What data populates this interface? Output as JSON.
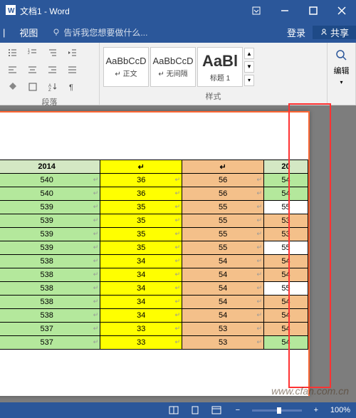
{
  "titlebar": {
    "title": "文档1 - Word"
  },
  "menubar": {
    "view_tab": "视图",
    "tell_me": "告诉我您想要做什么...",
    "login": "登录",
    "share": "共享"
  },
  "ribbon": {
    "paragraph_label": "段落",
    "styles_label": "样式",
    "edit_label": "编辑",
    "styles": [
      {
        "preview": "AaBbCcD",
        "name": "↵ 正文"
      },
      {
        "preview": "AaBbCcD",
        "name": "↵ 无间隔"
      },
      {
        "preview": "AaBl",
        "name": "标题 1"
      }
    ]
  },
  "table": {
    "headers": [
      "2014",
      "",
      "",
      "20"
    ],
    "rows": [
      {
        "c1": "540",
        "c2": "36",
        "c3": "56",
        "c4": "54",
        "c4bg": "green"
      },
      {
        "c1": "540",
        "c2": "36",
        "c3": "56",
        "c4": "54",
        "c4bg": "green"
      },
      {
        "c1": "539",
        "c2": "35",
        "c3": "55",
        "c4": "55",
        "c4bg": "white"
      },
      {
        "c1": "539",
        "c2": "35",
        "c3": "55",
        "c4": "53",
        "c4bg": "orange"
      },
      {
        "c1": "539",
        "c2": "35",
        "c3": "55",
        "c4": "53",
        "c4bg": "orange"
      },
      {
        "c1": "539",
        "c2": "35",
        "c3": "55",
        "c4": "55",
        "c4bg": "white"
      },
      {
        "c1": "538",
        "c2": "34",
        "c3": "54",
        "c4": "54",
        "c4bg": "orange"
      },
      {
        "c1": "538",
        "c2": "34",
        "c3": "54",
        "c4": "54",
        "c4bg": "orange"
      },
      {
        "c1": "538",
        "c2": "34",
        "c3": "54",
        "c4": "55",
        "c4bg": "white"
      },
      {
        "c1": "538",
        "c2": "34",
        "c3": "54",
        "c4": "54",
        "c4bg": "orange"
      },
      {
        "c1": "538",
        "c2": "34",
        "c3": "54",
        "c4": "54",
        "c4bg": "orange"
      },
      {
        "c1": "537",
        "c2": "33",
        "c3": "53",
        "c4": "54",
        "c4bg": "orange"
      },
      {
        "c1": "537",
        "c2": "33",
        "c3": "53",
        "c4": "54",
        "c4bg": "green"
      }
    ]
  },
  "statusbar": {
    "zoom": "100%"
  },
  "watermark": "www.cfan.com.cn"
}
